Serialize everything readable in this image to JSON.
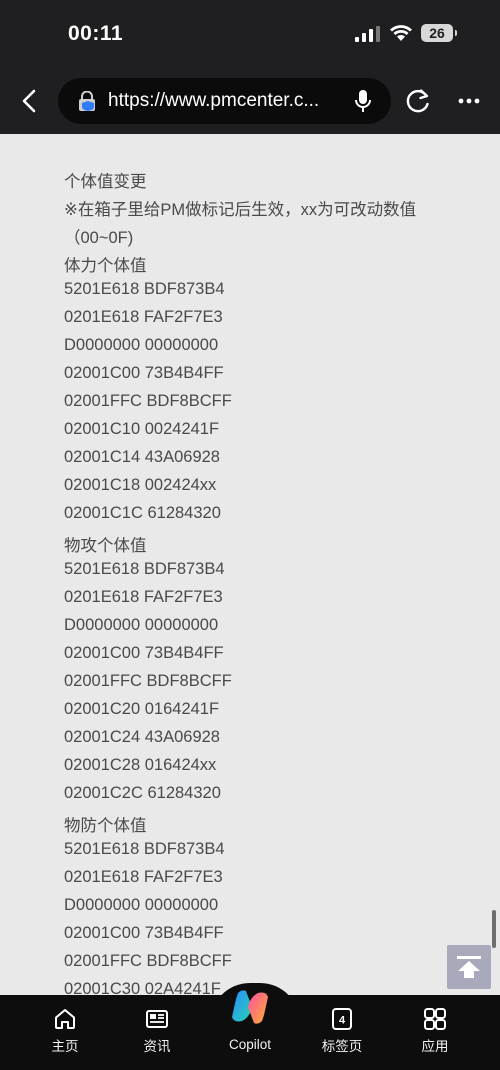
{
  "status_bar": {
    "time": "00:11",
    "battery": "26"
  },
  "browser": {
    "url": "https://www.pmcenter.c..."
  },
  "content": {
    "lines": [
      "个体值变更",
      "※在箱子里给PM做标记后生效，xx为可改动数值",
      "（00~0F)",
      "体力个体值",
      "5201E618 BDF873B4",
      "0201E618 FAF2F7E3",
      "D0000000 00000000",
      "02001C00 73B4B4FF",
      "02001FFC BDF8BCFF",
      "02001C10 0024241F",
      "02001C14 43A06928",
      "02001C18 002424xx",
      "02001C1C 61284320",
      "物攻个体值",
      "5201E618 BDF873B4",
      "0201E618 FAF2F7E3",
      "D0000000 00000000",
      "02001C00 73B4B4FF",
      "02001FFC BDF8BCFF",
      "02001C20 0164241F",
      "02001C24 43A06928",
      "02001C28 016424xx",
      "02001C2C 61284320",
      "物防个体值",
      "5201E618 BDF873B4",
      "0201E618 FAF2F7E3",
      "D0000000 00000000",
      "02001C00 73B4B4FF",
      "02001FFC BDF8BCFF",
      "02001C30 02A4241F"
    ]
  },
  "bottom_nav": {
    "home": "主页",
    "news": "资讯",
    "copilot": "Copilot",
    "tabs": "标签页",
    "tab_count": "4",
    "apps": "应用"
  },
  "colors": {
    "chrome": "#1f1f21",
    "page_bg": "#e9e9e9",
    "text": "#4a4a4a",
    "bottom_bar": "#0d0d0e"
  },
  "icons": {
    "status": [
      "signal-icon",
      "wifi-icon",
      "battery-icon"
    ],
    "toolbar": [
      "back-icon",
      "lock-icon",
      "mic-icon",
      "refresh-icon",
      "more-icon"
    ],
    "nav": [
      "home-icon",
      "news-icon",
      "copilot-icon",
      "tabs-icon",
      "apps-icon"
    ],
    "page": [
      "scroll-top-icon"
    ]
  }
}
